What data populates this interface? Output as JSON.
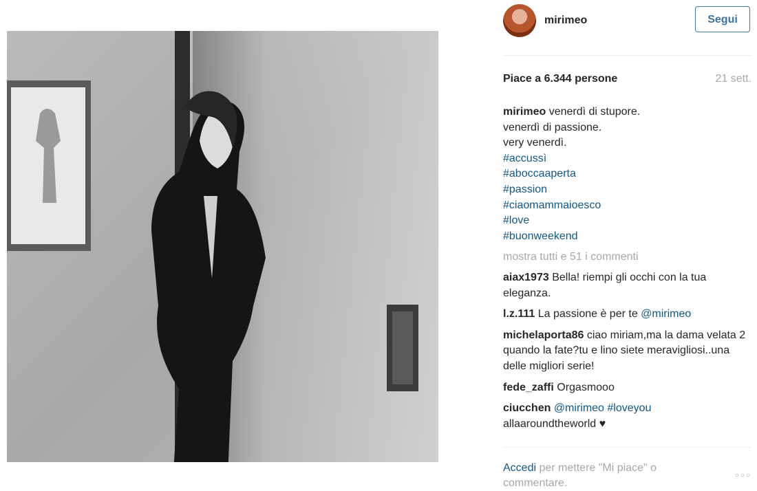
{
  "post": {
    "username": "mirimeo",
    "follow_label": "Segui",
    "likes_text": "Piace a 6.344 persone",
    "timestamp": "21 sett.",
    "caption_lines": [
      "venerdì di stupore.",
      "venerdì di passione.",
      "very venerdì."
    ],
    "hashtags": [
      "#accussì",
      "#aboccaaperta",
      "#passion",
      "#ciaomammaioesco",
      "#love",
      "#buonweekend"
    ],
    "show_all_comments": "mostra tutti e 51 i commenti"
  },
  "comments": [
    {
      "user": "aiax1973",
      "text": "Bella! riempi gli occhi con la tua eleganza."
    },
    {
      "user": "l.z.111",
      "text": "La passione è per te ",
      "mention": "@mirimeo"
    },
    {
      "user": "michelaporta86",
      "text": "ciao miriam,ma la dama velata 2 quando la fate?tu e lino siete meravigliosi..una delle migliori serie!"
    },
    {
      "user": "fede_zaffi",
      "text": "Orgasmooo"
    },
    {
      "user": "ciucchen",
      "mention": "@mirimeo",
      "tag": "#loveyou",
      "text": "allaaroundtheworld ♥"
    }
  ],
  "footer": {
    "login_link": "Accedi",
    "rest": " per mettere \"Mi piace\" o commentare.",
    "more_icon": "more-options-icon"
  }
}
